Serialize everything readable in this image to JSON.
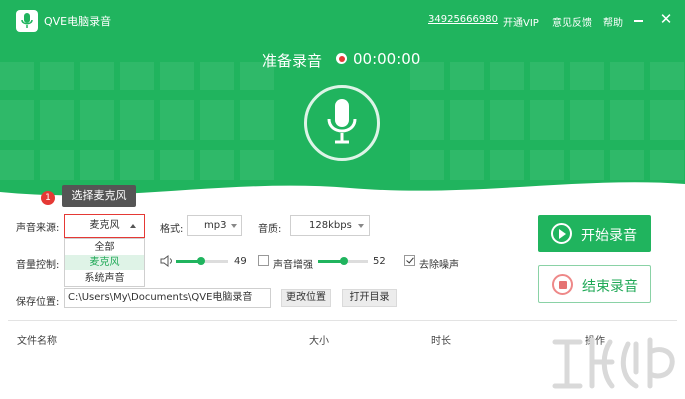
{
  "app": {
    "name": "QVE电脑录音",
    "account": "34925666980",
    "vip_label": "开通VIP",
    "feedback_label": "意见反馈",
    "help_label": "帮助",
    "close_glyph": "✕"
  },
  "recorder": {
    "status": "准备录音",
    "time": "00:00:00"
  },
  "tooltip": {
    "step": "1",
    "text": "选择麦克风"
  },
  "source": {
    "label": "声音来源:",
    "selected": "麦克风",
    "options": [
      "全部",
      "麦克风",
      "系统声音"
    ]
  },
  "format": {
    "label": "格式:",
    "value": "mp3"
  },
  "quality": {
    "label": "音质:",
    "value": "128kbps"
  },
  "volume": {
    "label": "音量控制:",
    "value": "49",
    "level": 0.49
  },
  "boost": {
    "label": "声音增强",
    "checked": false,
    "value": "52",
    "level": 0.52
  },
  "denoise": {
    "label": "去除噪声",
    "checked": true
  },
  "save": {
    "label": "保存位置:",
    "path": "C:\\Users\\My\\Documents\\QVE电脑录音",
    "change_label": "更改位置",
    "open_label": "打开目录"
  },
  "actions": {
    "start_label": "开始录音",
    "stop_label": "结束录音"
  },
  "file_table": {
    "headers": [
      "文件名称",
      "大小",
      "时长",
      "操作"
    ],
    "rows": []
  },
  "colors": {
    "brand_green": "#20b45e",
    "record_red": "#e53935"
  }
}
